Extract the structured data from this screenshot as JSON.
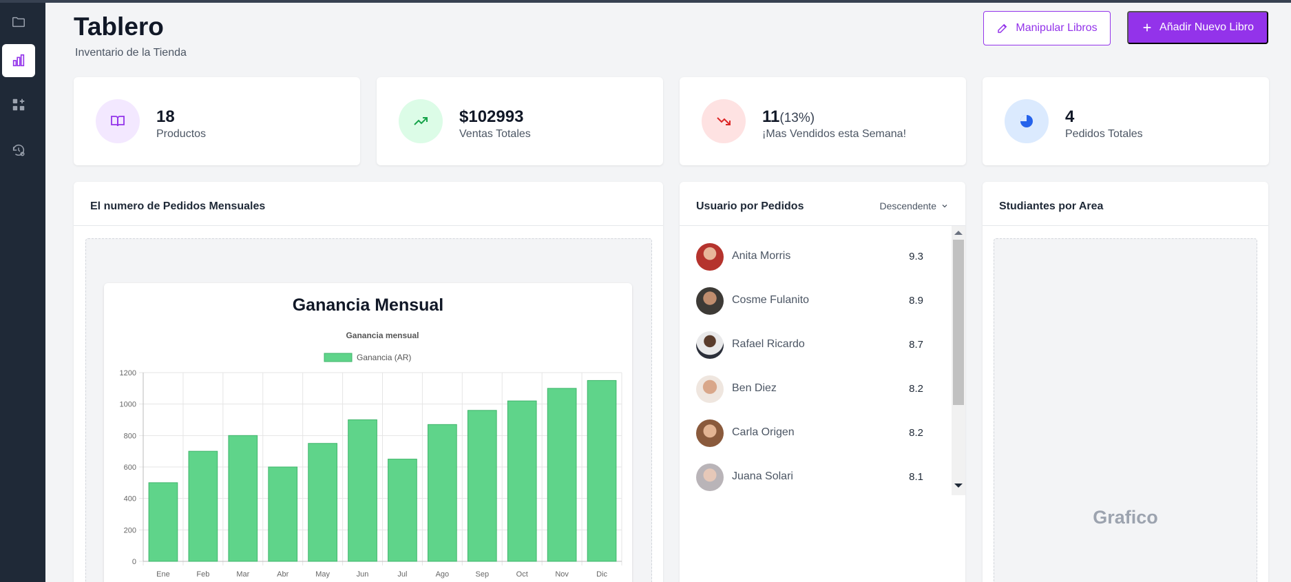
{
  "sidebar": {
    "items": [
      {
        "icon": "folder-icon"
      },
      {
        "icon": "bar-chart-icon",
        "active": true
      },
      {
        "icon": "grid-add-icon"
      },
      {
        "icon": "history-settings-icon"
      }
    ]
  },
  "header": {
    "title": "Tablero",
    "subtitle": "Inventario de la Tienda",
    "manipulate_label": "Manipular Libros",
    "add_label": "Añadir Nuevo Libro"
  },
  "stats": [
    {
      "value": "18",
      "label": "Productos",
      "icon": "book-icon",
      "color": "#9333ea",
      "bg": "#f3e8ff"
    },
    {
      "value": "$102993",
      "label": "Ventas Totales",
      "icon": "trend-up-icon",
      "color": "#16a34a",
      "bg": "#dcfce7"
    },
    {
      "value": "11",
      "extra": "(13%)",
      "label": "¡Mas Vendidos esta Semana!",
      "icon": "trend-down-icon",
      "color": "#dc2626",
      "bg": "#fee2e2"
    },
    {
      "value": "4",
      "label": "Pedidos Totales",
      "icon": "pie-icon",
      "color": "#2563eb",
      "bg": "#dbeafe"
    }
  ],
  "monthly_panel": {
    "title": "El numero de Pedidos Mensuales",
    "chart_heading": "Ganancia Mensual"
  },
  "users_panel": {
    "title": "Usuario por Pedidos",
    "sort_label": "Descendente",
    "users": [
      {
        "name": "Anita Morris",
        "score": "9.3"
      },
      {
        "name": "Cosme Fulanito",
        "score": "8.9"
      },
      {
        "name": "Rafael Ricardo",
        "score": "8.7"
      },
      {
        "name": "Ben Diez",
        "score": "8.2"
      },
      {
        "name": "Carla Origen",
        "score": "8.2"
      },
      {
        "name": "Juana Solari",
        "score": "8.1"
      }
    ]
  },
  "area_panel": {
    "title": "Studiantes por Area",
    "placeholder": "Grafico"
  },
  "colors": {
    "accent": "#9333ea",
    "bar_fill": "#5fd48a",
    "bar_stroke": "#3fb56b"
  },
  "chart_data": {
    "type": "bar",
    "title": "Ganancia mensual",
    "categories": [
      "Ene",
      "Feb",
      "Mar",
      "Abr",
      "May",
      "Jun",
      "Jul",
      "Ago",
      "Sep",
      "Oct",
      "Nov",
      "Dic"
    ],
    "series": [
      {
        "name": "Ganancia (AR)",
        "values": [
          500,
          700,
          800,
          600,
          750,
          900,
          650,
          870,
          960,
          1020,
          1100,
          1150
        ]
      }
    ],
    "ylim": [
      0,
      1200
    ],
    "yticks": [
      0,
      200,
      400,
      600,
      800,
      1000,
      1200
    ],
    "grid": true,
    "legend": "top"
  }
}
